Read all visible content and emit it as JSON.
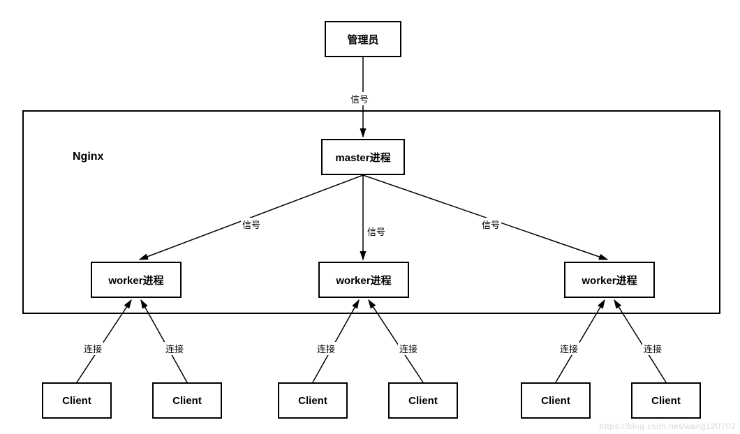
{
  "nodes": {
    "admin": {
      "label": "管理员"
    },
    "nginx": {
      "label": "Nginx"
    },
    "master": {
      "label": "master进程"
    },
    "worker1": {
      "label": "worker进程"
    },
    "worker2": {
      "label": "worker进程"
    },
    "worker3": {
      "label": "worker进程"
    },
    "client1": {
      "label": "Client"
    },
    "client2": {
      "label": "Client"
    },
    "client3": {
      "label": "Client"
    },
    "client4": {
      "label": "Client"
    },
    "client5": {
      "label": "Client"
    },
    "client6": {
      "label": "Client"
    }
  },
  "edges": {
    "admin_master": {
      "label": "信号"
    },
    "master_worker1": {
      "label": "信号"
    },
    "master_worker2": {
      "label": "信号"
    },
    "master_worker3": {
      "label": "信号"
    },
    "client1_worker1": {
      "label": "连接"
    },
    "client2_worker1": {
      "label": "连接"
    },
    "client3_worker2": {
      "label": "连接"
    },
    "client4_worker2": {
      "label": "连接"
    },
    "client5_worker3": {
      "label": "连接"
    },
    "client6_worker3": {
      "label": "连接"
    }
  },
  "watermark": "https://blog.csdn.net/wang120702"
}
